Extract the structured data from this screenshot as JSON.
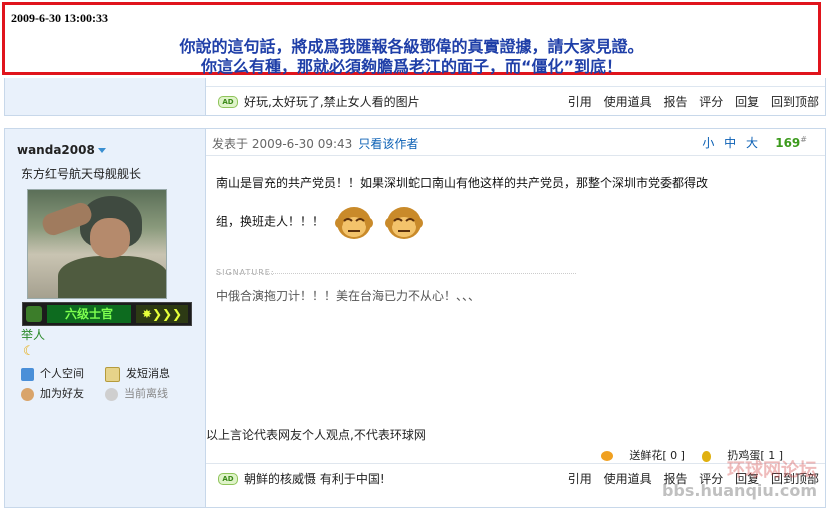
{
  "banner": {
    "timestamp": "2009-6-30 13:00:33",
    "line1": "你說的這句話，將成爲我匯報各級鄧偉的真實證據，請大家見證。",
    "line2": "你這么有種，那就必須夠膽爲老江的面子，而“僵化”到底！"
  },
  "prev_post": {
    "ad_badge": "AD",
    "ad_text": "好玩,太好玩了,禁止女人看的图片",
    "actions": [
      "引用",
      "使用道具",
      "报告",
      "评分",
      "回复",
      "回到顶部"
    ]
  },
  "post": {
    "username": "wanda2008",
    "user_title": "东方红号航天母舰舰长",
    "rank_name": "六级士官",
    "rank_level": "举人",
    "user_links": {
      "space": "个人空间",
      "message": "发短消息",
      "add_friend": "加为好友",
      "status": "当前离线"
    },
    "posted_label": "发表于 2009-6-30 09:43",
    "author_only": "只看该作者",
    "font_sizes": "小 中 大",
    "floor": "169",
    "floor_mark": "#",
    "content_line1": "南山是冒充的共产党员！！如果深圳蛇口南山有他这样的共产党员，那整个深圳市党委都得改",
    "content_line2": "组，换班走人！！！",
    "signature_label": "SIGNATURE:",
    "signature_text": "中俄合演拖刀计！！！美在台海已力不从心！、、、",
    "disclaimer": "以上言论代表网友个人观点,不代表环球网",
    "gift_flower": "送鲜花[ 0 ]",
    "gift_egg": "扔鸡蛋[ 1 ]",
    "ad_badge": "AD",
    "ad_text": "朝鲜的核威慑  有利于中国!",
    "actions": [
      "引用",
      "使用道具",
      "报告",
      "评分",
      "回复",
      "回到顶部"
    ]
  },
  "watermark": {
    "brand": "环球网论坛",
    "url": "bbs.huanqiu.com"
  }
}
